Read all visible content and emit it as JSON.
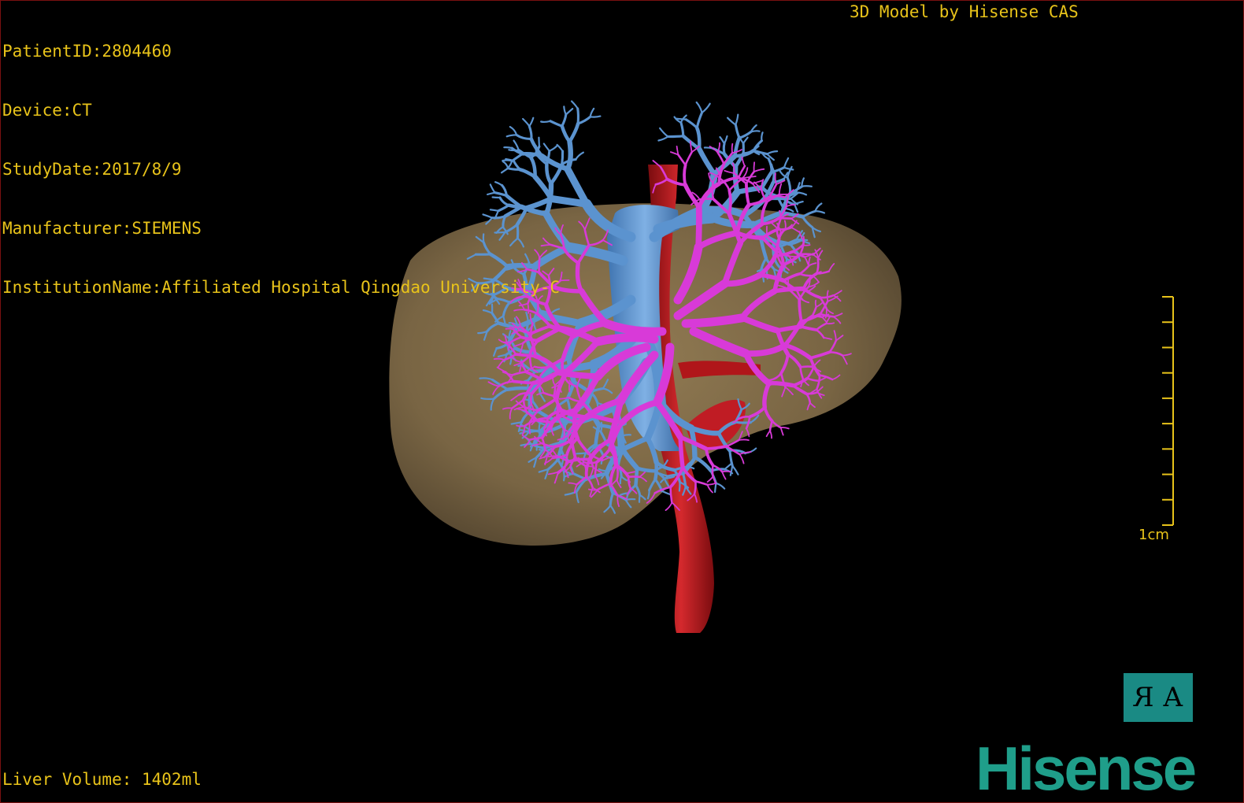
{
  "overlay": {
    "patient_id": "PatientID:2804460",
    "device": "Device:CT",
    "study_date": "StudyDate:2017/8/9",
    "manufacturer": "Manufacturer:SIEMENS",
    "institution": "InstitutionName:Affiliated Hospital Qingdao University-C",
    "credit": "3D Model by Hisense CAS",
    "liver_volume": "Liver Volume: 1402ml"
  },
  "scale": {
    "label": "1cm"
  },
  "orientation_cube": {
    "left": "R",
    "right": "A"
  },
  "brand": {
    "logo_text": "Hisense"
  },
  "colors": {
    "overlay_text": "#e8c31a",
    "liver": "#8c7550",
    "portal_vein": "#d83ad8",
    "hepatic_vein": "#5b93cf",
    "artery": "#b0161a",
    "brand": "#1f9e8a"
  }
}
